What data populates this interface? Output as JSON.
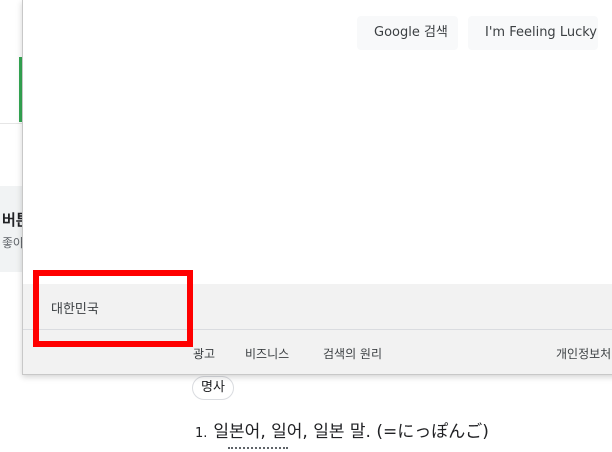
{
  "background": {
    "card_title": "버튼",
    "card_subtitle": "좋아요",
    "noun_label": "명사",
    "definition_number": "1.",
    "definition_text": "일본어, 일어, 일본 말. (=にっぽんご)"
  },
  "panel": {
    "buttons": {
      "search": "Google 검색",
      "lucky": "I'm Feeling Lucky"
    },
    "footer": {
      "country": "대한민국",
      "links": {
        "ads": "광고",
        "business": "비즈니스",
        "how_search_works": "검색의 원리",
        "privacy": "개인정보처"
      }
    }
  },
  "highlight": {
    "color": "#ff0000",
    "target": "footer-country"
  }
}
